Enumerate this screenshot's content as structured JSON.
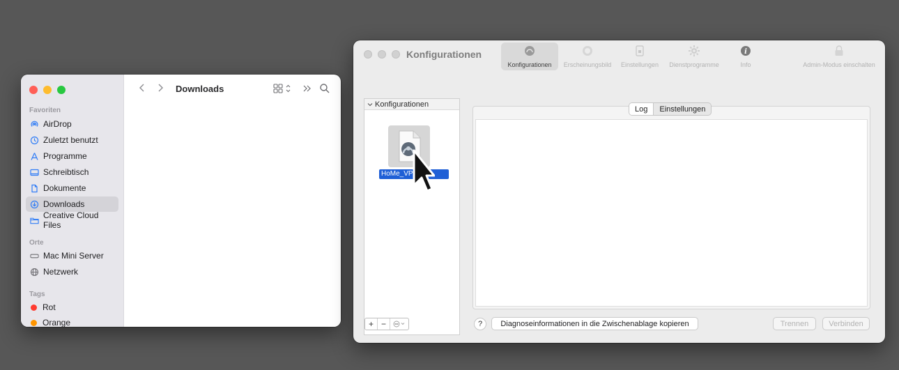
{
  "finder": {
    "title": "Downloads",
    "sections": {
      "favorites": "Favoriten",
      "places": "Orte",
      "tags": "Tags"
    },
    "favorites": [
      {
        "label": "AirDrop",
        "icon": "airdrop-icon"
      },
      {
        "label": "Zuletzt benutzt",
        "icon": "clock-icon"
      },
      {
        "label": "Programme",
        "icon": "apps-icon"
      },
      {
        "label": "Schreibtisch",
        "icon": "desktop-icon"
      },
      {
        "label": "Dokumente",
        "icon": "document-icon"
      },
      {
        "label": "Downloads",
        "icon": "download-icon",
        "selected": true
      },
      {
        "label": "Creative Cloud Files",
        "icon": "folder-icon"
      }
    ],
    "places": [
      {
        "label": "Mac Mini Server",
        "icon": "display-icon"
      },
      {
        "label": "Netzwerk",
        "icon": "globe-icon"
      }
    ],
    "tags": [
      {
        "label": "Rot",
        "color": "#ff3b30"
      },
      {
        "label": "Orange",
        "color": "#ff9500"
      }
    ]
  },
  "tunnelblick": {
    "title": "Konfigurationen",
    "toolbar": [
      {
        "label": "Konfigurationen",
        "icon": "vpn-icon",
        "active": true
      },
      {
        "label": "Erscheinungsbild",
        "icon": "appearance-icon"
      },
      {
        "label": "Einstellungen",
        "icon": "settings-icon"
      },
      {
        "label": "Dienstprogramme",
        "icon": "gear-icon"
      },
      {
        "label": "Info",
        "icon": "info-icon"
      },
      {
        "label": "Admin-Modus einschalten",
        "icon": "lock-icon"
      }
    ],
    "config_header": "Konfigurationen",
    "config_file_label": "HoMe_VP",
    "tabs": [
      "Log",
      "Einstellungen"
    ],
    "help": "?",
    "diagnose_button": "Diagnoseinformationen in die Zwischenablage kopieren",
    "disconnect_button": "Trennen",
    "connect_button": "Verbinden",
    "add_button": "+",
    "remove_button": "−"
  },
  "colors": {
    "desktop": "#575757",
    "selection": "#1f5fd6",
    "accent": "#2f7cf6"
  }
}
